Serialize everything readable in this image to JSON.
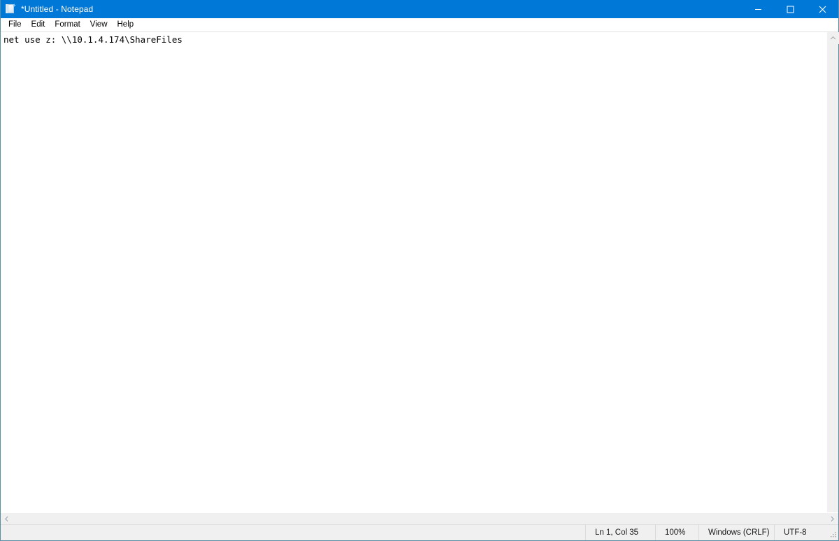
{
  "window": {
    "title": "*Untitled - Notepad",
    "icon": "notepad-icon",
    "accent_color": "#0078d7",
    "border_color": "#5b8ea3",
    "controls": [
      {
        "name": "minimize",
        "glyph": "minimize-icon",
        "label": "Minimize"
      },
      {
        "name": "maximize",
        "glyph": "maximize-icon",
        "label": "Maximize"
      },
      {
        "name": "close",
        "glyph": "close-icon",
        "label": "Close"
      }
    ]
  },
  "menubar": {
    "items": [
      {
        "label": "File"
      },
      {
        "label": "Edit"
      },
      {
        "label": "Format"
      },
      {
        "label": "View"
      },
      {
        "label": "Help"
      }
    ]
  },
  "editor": {
    "content": "net use z: \\\\10.1.4.174\\ShareFiles",
    "lines": [
      "net use z: \\\\10.1.4.174\\ShareFiles"
    ],
    "background": "#ffffff",
    "text_color": "#000000"
  },
  "scrollbars": {
    "vertical": {
      "up_arrow": "chevron-up-icon",
      "visible": true
    },
    "horizontal": {
      "left_arrow": "chevron-left-icon",
      "right_arrow": "chevron-right-icon",
      "visible": true
    }
  },
  "statusbar": {
    "cursor_position": "Ln 1, Col 35",
    "zoom": "100%",
    "line_ending": "Windows (CRLF)",
    "encoding": "UTF-8",
    "grip": "resize-grip-icon"
  }
}
